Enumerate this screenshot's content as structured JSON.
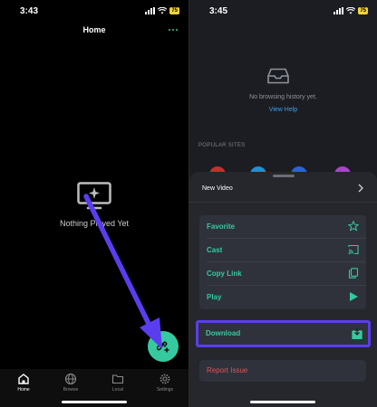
{
  "left": {
    "status": {
      "time": "3:43",
      "battery": "75"
    },
    "header": {
      "title": "Home"
    },
    "empty_state": {
      "text": "Nothing Played Yet"
    },
    "tabs": [
      {
        "label": "Home",
        "icon": "home-icon"
      },
      {
        "label": "Browse",
        "icon": "globe-icon"
      },
      {
        "label": "Local",
        "icon": "folder-icon"
      },
      {
        "label": "Settings",
        "icon": "gear-icon"
      }
    ],
    "colors": {
      "accent": "#36c9a0",
      "annotation": "#5b3df0"
    }
  },
  "right": {
    "status": {
      "time": "3:45",
      "battery": "75"
    },
    "history": {
      "empty_text": "No browsing history yet.",
      "help_link": "View Help"
    },
    "popular_sites_label": "POPULAR SITES",
    "sheet": {
      "title": "New Video",
      "actions": [
        {
          "label": "Favorite",
          "icon": "star-icon"
        },
        {
          "label": "Cast",
          "icon": "cast-icon"
        },
        {
          "label": "Copy Link",
          "icon": "copy-icon"
        },
        {
          "label": "Play",
          "icon": "play-icon"
        }
      ],
      "download": {
        "label": "Download",
        "icon": "download-icon"
      },
      "report": {
        "label": "Report Issue"
      }
    },
    "colors": {
      "accent": "#36c9a0",
      "danger": "#e0545a",
      "link": "#3ea0e8",
      "highlight": "#5b3df0"
    }
  }
}
